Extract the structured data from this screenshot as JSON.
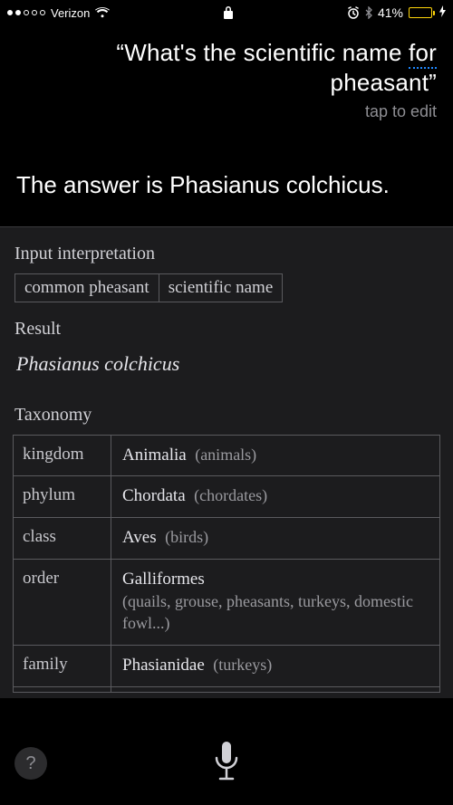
{
  "status_bar": {
    "carrier": "Verizon",
    "battery_percent": "41%"
  },
  "query": {
    "open_quote": "“",
    "line1": "What's the scientific name",
    "underlined_word": "for",
    "line2": "pheasant",
    "close_quote": "”",
    "tap_to_edit": "tap to edit"
  },
  "answer": "The answer is Phasianus colchicus.",
  "card": {
    "input_interpretation_h": "Input interpretation",
    "chips": {
      "left": "common pheasant",
      "right": "scientific name"
    },
    "result_h": "Result",
    "result_value": "Phasianus colchicus",
    "taxonomy_h": "Taxonomy",
    "rows": [
      {
        "rank": "kingdom",
        "name": "Animalia",
        "paren": "(animals)"
      },
      {
        "rank": "phylum",
        "name": "Chordata",
        "paren": "(chordates)"
      },
      {
        "rank": "class",
        "name": "Aves",
        "paren": "(birds)"
      },
      {
        "rank": "order",
        "name": "Galliformes",
        "paren": "(quails, grouse, pheasants, turkeys, domestic fowl...)",
        "multiline": true
      },
      {
        "rank": "family",
        "name": "Phasianidae",
        "paren": "(turkeys)"
      }
    ]
  },
  "help_label": "?"
}
